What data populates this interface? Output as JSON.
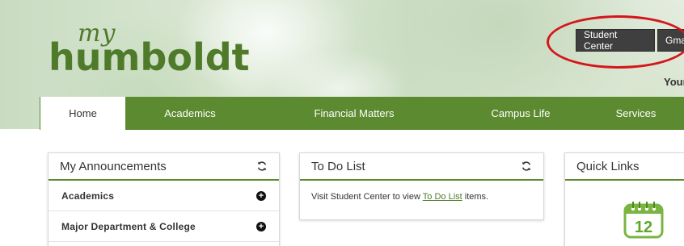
{
  "logo": {
    "my": "my",
    "name": "humboldt"
  },
  "header": {
    "student_center_label": "Student Center",
    "gmail_label": "Gmai",
    "welcome_text": "Your"
  },
  "nav": {
    "items": [
      {
        "label": "Home",
        "active": true
      },
      {
        "label": "Academics"
      },
      {
        "label": "Financial Matters"
      },
      {
        "label": "Campus Life"
      },
      {
        "label": "Services"
      }
    ]
  },
  "announcements": {
    "title": "My Announcements",
    "items": [
      {
        "label": "Academics"
      },
      {
        "label": "Major Department & College"
      }
    ]
  },
  "todo": {
    "title": "To Do List",
    "text_before": "Visit Student Center to view ",
    "link": "To Do List",
    "text_after": " items."
  },
  "quick_links": {
    "title": "Quick Links",
    "calendar_day": "12"
  },
  "colors": {
    "brand_green": "#5c8a30",
    "logo_green": "#4f7a2a",
    "highlight_red": "#d4161c",
    "button_dark": "#3f3f3f"
  },
  "icons": [
    "refresh-icon",
    "plus-circle-icon",
    "calendar-icon"
  ]
}
